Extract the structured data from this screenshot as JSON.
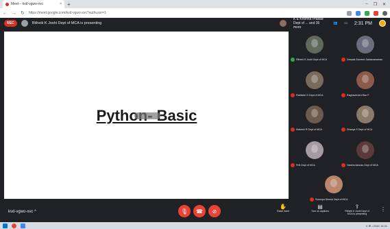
{
  "browser": {
    "tab_title": "Meet – kvd-vgwo-xvc",
    "tab_close": "×",
    "new_tab": "+",
    "window_controls": [
      "–",
      "❐",
      "✕"
    ],
    "url": "https://meet.google.com/kvd-vgwo-xvc?authuser=1"
  },
  "meet": {
    "rec_label": "REC",
    "presenting_text": "Ritheik K Joshi Dept of MCA is presenting",
    "pinned_text": "K E Krishna Prasad Dept of ... and 35 more",
    "clock": "2:31 PM"
  },
  "slide": {
    "title": "Python- Basic"
  },
  "participants": [
    {
      "name": "Ritheik K Joshi Dept of MCA",
      "color": "#5f6a5a"
    },
    {
      "name": "Deepak Sarvesh Sahasranaman",
      "color": "#6a6e7a"
    },
    {
      "name": "Rathishri G Dept of MCA",
      "color": "#7a6a5c"
    },
    {
      "name": "Raghavendra Rao P",
      "color": "#8a5a4a"
    },
    {
      "name": "Mahesh R Dept of MCA",
      "color": "#6b5a4d"
    },
    {
      "name": "Dhanya S Dept of MCA",
      "color": "#8a7a6a"
    },
    {
      "name": "Priti Dept of MCA",
      "color": "#a59aa0"
    },
    {
      "name": "Harsha kannan Dept of MCA",
      "color": "#5a3a3a"
    },
    {
      "name": "Sowmya Dinesh Dept of MCA",
      "color": "#b8866a"
    }
  ],
  "bottom": {
    "meeting_code": "kvd-vgwo-xvc ^",
    "mic_icon": "🎙",
    "hangup_icon": "☎",
    "cam_icon": "⊘",
    "controls": [
      {
        "icon": "✋",
        "label": "Raise hand"
      },
      {
        "icon": "▤",
        "label": "Turn on captions"
      },
      {
        "icon": "⇪",
        "label": "Ritheik K Joshi Dept of MCA is presenting"
      }
    ],
    "more": "⋮"
  },
  "taskbar": {
    "tray": "∧ ⊞ ♪ ENG 14:31"
  }
}
